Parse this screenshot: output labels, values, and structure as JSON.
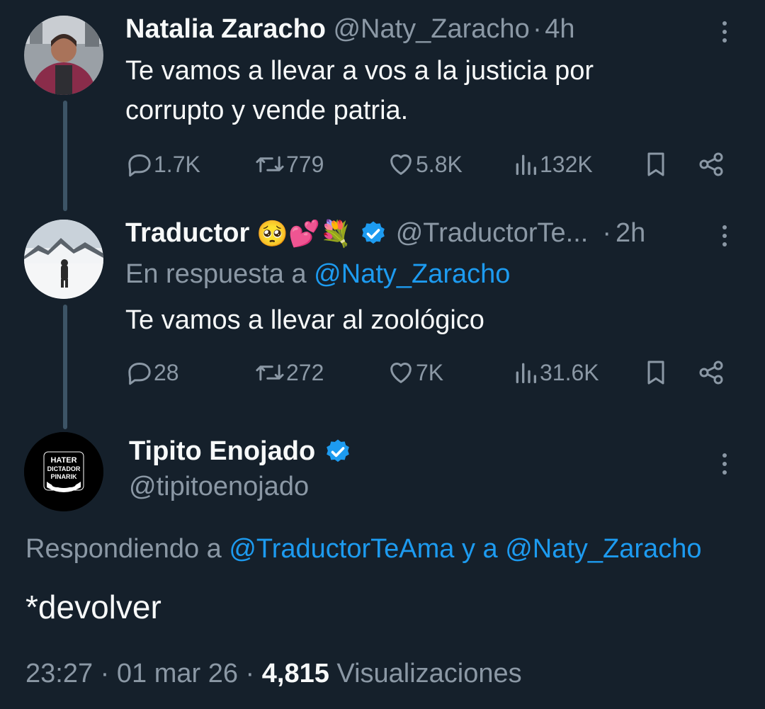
{
  "tweets": [
    {
      "name": "Natalia Zaracho",
      "handle": "@Naty_Zaracho",
      "sep": "·",
      "time": "4h",
      "text_line1": "Te vamos a llevar a vos a la justicia por",
      "text_line2": "corrupto y vende patria.",
      "replies": "1.7K",
      "retweets": "779",
      "likes": "5.8K",
      "views": "132K"
    },
    {
      "name": "Traductor",
      "emojis": [
        "🥺",
        "💕",
        "💐"
      ],
      "handle": "@TraductorTe...",
      "sep": "·",
      "time": "2h",
      "reply_prefix": "En respuesta a",
      "reply_to": "@Naty_Zaracho",
      "text": "Te vamos a llevar al zoológico",
      "replies": "28",
      "retweets": "272",
      "likes": "7K",
      "views": "31.6K"
    }
  ],
  "main": {
    "name": "Tipito Enojado",
    "handle": "@tipitoenojado",
    "avatar_text": [
      "HATER",
      "DICTADOR",
      "PINARIK"
    ],
    "replying_prefix": "Respondiendo a",
    "replying_to_1": "@TraductorTeAma",
    "replying_and": "y a",
    "replying_to_2": "@Naty_Zaracho",
    "text": "*devolver",
    "time": "23:27",
    "date": "01 mar 26",
    "sep": "·",
    "views_count": "4,815",
    "views_label": "Visualizaciones"
  },
  "colors": {
    "background": "#15202b",
    "text": "#f7f9f9",
    "secondary": "#8b98a5",
    "accent": "#1d9bf0",
    "thread_line": "#3d5466"
  },
  "icons": [
    "reply-icon",
    "retweet-icon",
    "like-icon",
    "views-icon",
    "bookmark-icon",
    "share-icon",
    "more-icon",
    "verified-icon"
  ]
}
